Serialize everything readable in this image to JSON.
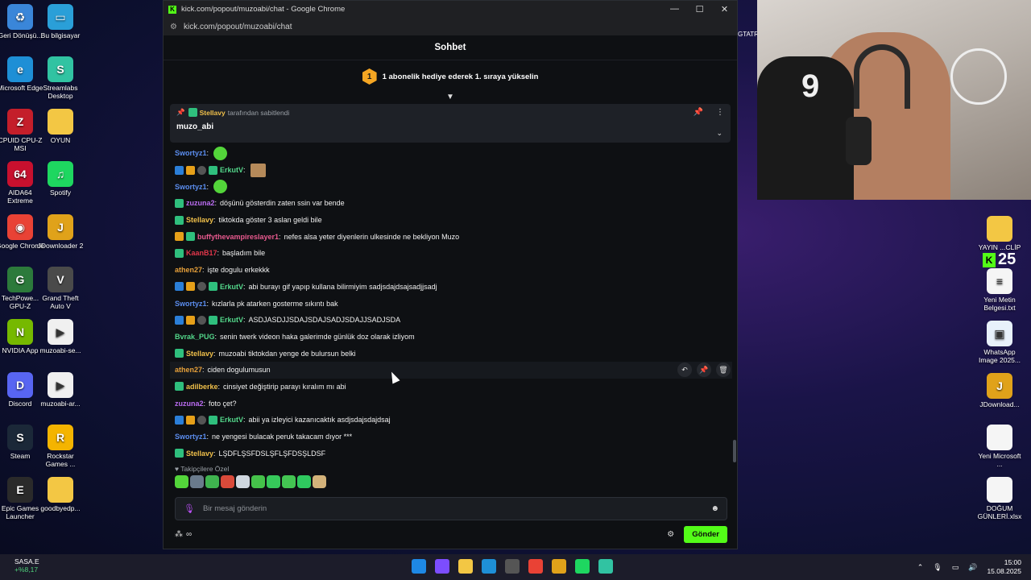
{
  "desktop": {
    "left_icons": [
      {
        "label": "Geri Dönüşü...",
        "color": "#3a86d9",
        "glyph": "♻"
      },
      {
        "label": "Bu bilgisayar",
        "color": "#2a9fd8",
        "glyph": "▭"
      },
      {
        "label": "Microsoft Edge",
        "color": "#1e8fd6",
        "glyph": "e"
      },
      {
        "label": "Streamlabs Desktop",
        "color": "#31c3a2",
        "glyph": "S"
      },
      {
        "label": "CPUID CPU-Z MSI",
        "color": "#c41e2a",
        "glyph": "Z"
      },
      {
        "label": "OYUN",
        "color": "#f3c744",
        "glyph": ""
      },
      {
        "label": "AIDA64 Extreme",
        "color": "#c8102e",
        "glyph": "64"
      },
      {
        "label": "Spotify",
        "color": "#1ed760",
        "glyph": "♫"
      },
      {
        "label": "Google Chrome",
        "color": "#e94235",
        "glyph": "◉"
      },
      {
        "label": "JDownloader 2",
        "color": "#e0a21a",
        "glyph": "J"
      },
      {
        "label": "TechPowe... GPU-Z",
        "color": "#2c7a3b",
        "glyph": "G"
      },
      {
        "label": "Grand Theft Auto V",
        "color": "#4a4a4a",
        "glyph": "V"
      },
      {
        "label": "NVIDIA App",
        "color": "#76b900",
        "glyph": "N"
      },
      {
        "label": "muzoabi-se...",
        "color": "#f0f0f0",
        "glyph": "▶"
      },
      {
        "label": "Discord",
        "color": "#5865f2",
        "glyph": "D"
      },
      {
        "label": "muzoabi-ar...",
        "color": "#f0f0f0",
        "glyph": "▶"
      },
      {
        "label": "Steam",
        "color": "#1b2838",
        "glyph": "S"
      },
      {
        "label": "Rockstar Games ...",
        "color": "#f4b400",
        "glyph": "R"
      },
      {
        "label": "Epic Games Launcher",
        "color": "#2a2a2a",
        "glyph": "E"
      },
      {
        "label": "goodbyedp...",
        "color": "#f3c744",
        "glyph": ""
      }
    ],
    "right_icons": [
      {
        "label": "YAYIN ...CLİP",
        "color": "#f3c744",
        "glyph": ""
      },
      {
        "label": "Yeni Metin Belgesi.txt",
        "color": "#f5f5f5",
        "glyph": "≡"
      },
      {
        "label": "WhatsApp Image 2025...",
        "color": "#e8f1fb",
        "glyph": "▣"
      },
      {
        "label": "JDownload...",
        "color": "#e0a21a",
        "glyph": "J"
      },
      {
        "label": "Yeni Microsoft ...",
        "color": "#f5f5f5",
        "glyph": ""
      },
      {
        "label": "DOĞUM GÜNLERİ.xlsx",
        "color": "#f5f5f5",
        "glyph": ""
      }
    ],
    "gtatr_label": "GTATR",
    "kick_count": "25"
  },
  "window": {
    "title": "kick.com/popout/muzoabi/chat - Google Chrome",
    "url": "kick.com/popout/muzoabi/chat",
    "controls": {
      "minimize": "—",
      "maximize": "☐",
      "close": "✕"
    }
  },
  "chat": {
    "header": "Sohbet",
    "promo_rank": "1",
    "promo_text": "1 abonelik hediye ederek 1. sıraya yükselin",
    "pinned": {
      "pinned_by_name": "Stellavy",
      "pinned_by_suffix": "tarafından sabitlendi",
      "message": "muzo_abi"
    },
    "messages": [
      {
        "badges": [],
        "user": "Swortyz1",
        "color": "#5b8def",
        "text": "",
        "emote": "green"
      },
      {
        "badges": [
          "mod",
          "vip",
          "og",
          "sub"
        ],
        "user": "ErkutV",
        "color": "#53d78a",
        "text": "",
        "emote": "square"
      },
      {
        "badges": [],
        "user": "Swortyz1",
        "color": "#5b8def",
        "text": "",
        "emote": "green"
      },
      {
        "badges": [
          "sub"
        ],
        "user": "zuzuna2",
        "color": "#b96cf0",
        "text": "döşünü gösterdin zaten ssin var bende",
        "emote": ""
      },
      {
        "badges": [
          "sub"
        ],
        "user": "Stellavy",
        "color": "#f0c04a",
        "text": "tiktokda göster 3 aslan geldi bile",
        "emote": ""
      },
      {
        "badges": [
          "vip",
          "sub"
        ],
        "user": "buffythevampireslayer1",
        "color": "#e95a8f",
        "text": "nefes alsa yeter diyenlerin ulkesinde ne bekliyon Muzo",
        "emote": ""
      },
      {
        "badges": [
          "sub"
        ],
        "user": "KaanB17",
        "color": "#e0364a",
        "text": "başladım bile",
        "emote": ""
      },
      {
        "badges": [],
        "user": "athen27",
        "color": "#e8a13a",
        "text": "işte dogulu erkekkk",
        "emote": ""
      },
      {
        "badges": [
          "mod",
          "vip",
          "og",
          "sub"
        ],
        "user": "ErkutV",
        "color": "#53d78a",
        "text": "abi burayı gif yapıp kullana bilirmiyim sadjsdajdsajsadjjsadj",
        "emote": ""
      },
      {
        "badges": [],
        "user": "Swortyz1",
        "color": "#5b8def",
        "text": "kızlarla pk atarken gosterme sıkıntı bak",
        "emote": ""
      },
      {
        "badges": [
          "mod",
          "vip",
          "og",
          "sub"
        ],
        "user": "ErkutV",
        "color": "#53d78a",
        "text": "ASDJASDJJSDAJSDAJSADJSDAJJSADJSDA",
        "emote": ""
      },
      {
        "badges": [],
        "user": "Bvrak_PUG",
        "color": "#53d78a",
        "text": "senin twerk videon haka galerimde günlük doz olarak izliyom",
        "emote": ""
      },
      {
        "badges": [
          "sub"
        ],
        "user": "Stellavy",
        "color": "#f0c04a",
        "text": "muzoabi tiktokdan yenge de bulursun belki",
        "emote": ""
      },
      {
        "badges": [],
        "user": "athen27",
        "color": "#e8a13a",
        "text": "ciden dogulumusun",
        "emote": "",
        "hover": true
      },
      {
        "badges": [
          "sub"
        ],
        "user": "adilberke",
        "color": "#f0c04a",
        "text": "cinsiyet değiştirip parayı kıralım mı abi",
        "emote": ""
      },
      {
        "badges": [],
        "user": "zuzuna2",
        "color": "#b96cf0",
        "text": "foto çet?",
        "emote": ""
      },
      {
        "badges": [
          "mod",
          "vip",
          "og",
          "sub"
        ],
        "user": "ErkutV",
        "color": "#53d78a",
        "text": "abii ya izleyici kazanıcaktık asdjsdajsdajdsaj",
        "emote": ""
      },
      {
        "badges": [],
        "user": "Swortyz1",
        "color": "#5b8def",
        "text": "ne yengesi bulacak peruk takacam dıyor ***",
        "emote": ""
      },
      {
        "badges": [
          "sub"
        ],
        "user": "Stellavy",
        "color": "#f0c04a",
        "text": "LŞDFLŞSFDSLŞFLŞFDSŞLDSF",
        "emote": ""
      }
    ],
    "followers_label": "Takipçilere Özel",
    "emote_colors": [
      "#53d53a",
      "#6a7b8c",
      "#3fb34f",
      "#d94a3a",
      "#cfd7df",
      "#45c24a",
      "#36c85a",
      "#43c552",
      "#2fc95f",
      "#d3b27a"
    ],
    "input_placeholder": "Bir mesaj gönderin",
    "infinity_label": "∞",
    "send_label": "Gönder"
  },
  "taskbar": {
    "weather_name": "SASA.E",
    "weather_change": "+%8,17",
    "time": "15:00",
    "date": "15.08.2025",
    "app_colors": [
      "#1e88e5",
      "#7c4dff",
      "#f3c744",
      "#1e8fd6",
      "#555555",
      "#e94235",
      "#e0a21a",
      "#1ed760",
      "#31c3a2"
    ]
  },
  "accent": "#53fc18"
}
